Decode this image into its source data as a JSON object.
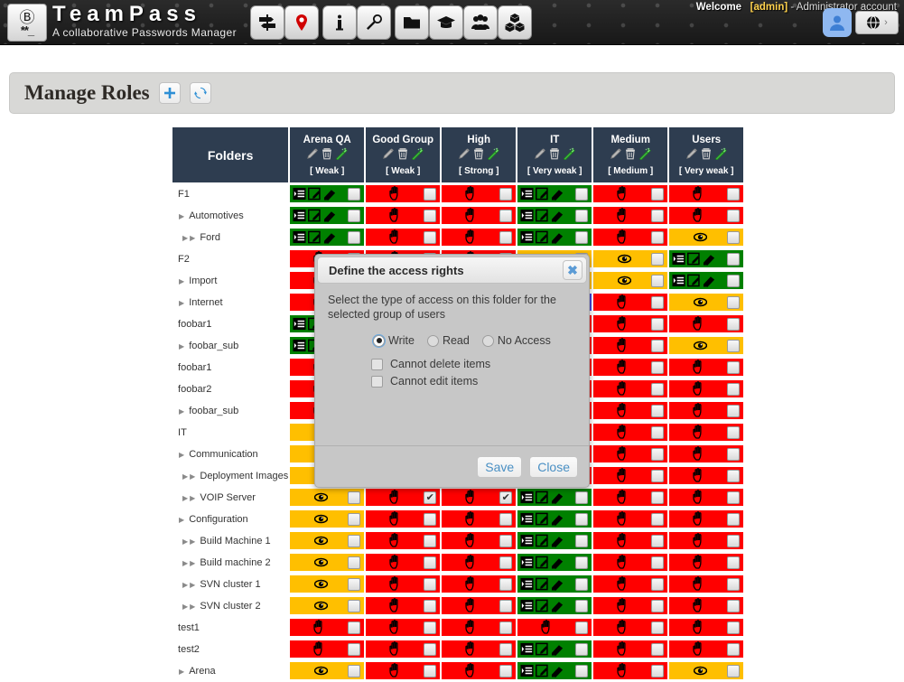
{
  "topbar": {
    "logo_icon": "lock-icon",
    "brand_name": "TeamPass",
    "brand_tagline": "A collaborative Passwords Manager",
    "nav_icons": [
      {
        "name": "signpost-icon",
        "label": "Items"
      },
      {
        "name": "pin-icon",
        "label": "Favourites"
      },
      {
        "name": "info-icon",
        "label": "Information"
      },
      {
        "name": "wrench-icon",
        "label": "Tools"
      },
      {
        "name": "folder-icon",
        "label": "Folders"
      },
      {
        "name": "graduation-cap-icon",
        "label": "Roles"
      },
      {
        "name": "users-icon",
        "label": "Users"
      },
      {
        "name": "cubes-icon",
        "label": "Utilities"
      }
    ],
    "welcome_label": "Welcome",
    "username": "[admin]",
    "account_role": "- Administrator account",
    "avatar_icon": "user-avatar-icon",
    "lang_icon": "globe-icon",
    "lang_chevron": "›"
  },
  "page": {
    "title": "Manage Roles",
    "add_icon": "plus-icon",
    "refresh_icon": "refresh-icon"
  },
  "table": {
    "corner_label": "Folders",
    "columns": [
      {
        "name": "Arena QA",
        "strength": "[ Weak ]"
      },
      {
        "name": "Good Group",
        "strength": "[ Weak ]"
      },
      {
        "name": "High",
        "strength": "[ Strong ]"
      },
      {
        "name": "IT",
        "strength": "[ Very weak ]"
      },
      {
        "name": "Medium",
        "strength": "[ Medium ]"
      },
      {
        "name": "Users",
        "strength": "[ Very weak ]"
      }
    ],
    "column_icons": [
      "pencil-icon",
      "trash-icon",
      "wand-icon"
    ],
    "access_icons": {
      "write": [
        "list-icon",
        "edit-icon",
        "eraser-icon"
      ],
      "write_partial": [
        "list-icon",
        "edit-icon"
      ],
      "read": [
        "eye-icon"
      ],
      "none": [
        "hand-icon"
      ]
    },
    "rows": [
      {
        "label": "F1",
        "depth": 0,
        "cells": [
          "w",
          "n",
          "n",
          "w",
          "n",
          "n"
        ]
      },
      {
        "label": "Automotives",
        "depth": 1,
        "cells": [
          "w",
          "n",
          "n",
          "w",
          "n",
          "n"
        ]
      },
      {
        "label": "Ford",
        "depth": 2,
        "cells": [
          "w",
          "n",
          "n",
          "w",
          "n",
          "r"
        ]
      },
      {
        "label": "F2",
        "depth": 0,
        "cells": [
          "n",
          "n",
          "n",
          "r",
          "r",
          "w"
        ]
      },
      {
        "label": "Import",
        "depth": 1,
        "cells": [
          "n",
          "n",
          "n",
          "r",
          "r",
          "w"
        ]
      },
      {
        "label": "Internet",
        "depth": 1,
        "cells": [
          "n",
          "n",
          "n",
          "sel",
          "n",
          "r"
        ]
      },
      {
        "label": "foobar1",
        "depth": 0,
        "cells": [
          "wp",
          "n",
          "n",
          "n",
          "n",
          "n"
        ]
      },
      {
        "label": "foobar_sub",
        "depth": 1,
        "cells": [
          "wp",
          "n",
          "n",
          "n",
          "n",
          "r"
        ]
      },
      {
        "label": "foobar1",
        "depth": 0,
        "cells": [
          "n",
          "n",
          "n",
          "n",
          "n",
          "n"
        ]
      },
      {
        "label": "foobar2",
        "depth": 0,
        "cells": [
          "n",
          "n",
          "n",
          "n",
          "n",
          "n"
        ]
      },
      {
        "label": "foobar_sub",
        "depth": 1,
        "cells": [
          "n",
          "n",
          "n",
          "n",
          "n",
          "n"
        ]
      },
      {
        "label": "IT",
        "depth": 0,
        "cells": [
          "r",
          "n",
          "n",
          "n",
          "n",
          "n"
        ]
      },
      {
        "label": "Communication",
        "depth": 1,
        "cells": [
          "r",
          "n",
          "n",
          "n",
          "n",
          "n"
        ]
      },
      {
        "label": "Deployment Images",
        "depth": 2,
        "cells": [
          "r",
          "n",
          "n",
          "n",
          "n",
          "n"
        ]
      },
      {
        "label": "VOIP Server",
        "depth": 2,
        "cells": [
          "r",
          "n*",
          "n*",
          "w",
          "n",
          "n"
        ]
      },
      {
        "label": "Configuration",
        "depth": 1,
        "cells": [
          "r",
          "n",
          "n",
          "w",
          "n",
          "n"
        ]
      },
      {
        "label": "Build Machine 1",
        "depth": 2,
        "cells": [
          "r",
          "n",
          "n",
          "w",
          "n",
          "n"
        ]
      },
      {
        "label": "Build machine 2",
        "depth": 2,
        "cells": [
          "r",
          "n",
          "n",
          "w",
          "n",
          "n"
        ]
      },
      {
        "label": "SVN cluster 1",
        "depth": 2,
        "cells": [
          "r",
          "n",
          "n",
          "w",
          "n",
          "n"
        ]
      },
      {
        "label": "SVN cluster 2",
        "depth": 2,
        "cells": [
          "r",
          "n",
          "n",
          "w",
          "n",
          "n"
        ]
      },
      {
        "label": "test1",
        "depth": 0,
        "cells": [
          "n",
          "n",
          "n",
          "n",
          "n",
          "n"
        ]
      },
      {
        "label": "test2",
        "depth": 0,
        "cells": [
          "n",
          "n",
          "n",
          "w",
          "n",
          "n"
        ]
      },
      {
        "label": "Arena",
        "depth": 1,
        "cells": [
          "r",
          "n",
          "n",
          "w",
          "n",
          "r"
        ]
      }
    ]
  },
  "modal": {
    "title": "Define the access rights",
    "close_icon": "close-icon",
    "description": "Select the type of access on this folder for the selected group of users",
    "radios": [
      {
        "label": "Write",
        "selected": true
      },
      {
        "label": "Read",
        "selected": false
      },
      {
        "label": "No Access",
        "selected": false
      }
    ],
    "checkboxes": [
      {
        "label": "Cannot delete items",
        "checked": false
      },
      {
        "label": "Cannot edit items",
        "checked": false
      }
    ],
    "save_label": "Save",
    "close_label": "Close"
  },
  "colors": {
    "write": "#008000",
    "read": "#ffbf00",
    "none": "#ff0000",
    "selected": "#4444dd",
    "header": "#2e3d50",
    "accent": "#4a90c4"
  }
}
